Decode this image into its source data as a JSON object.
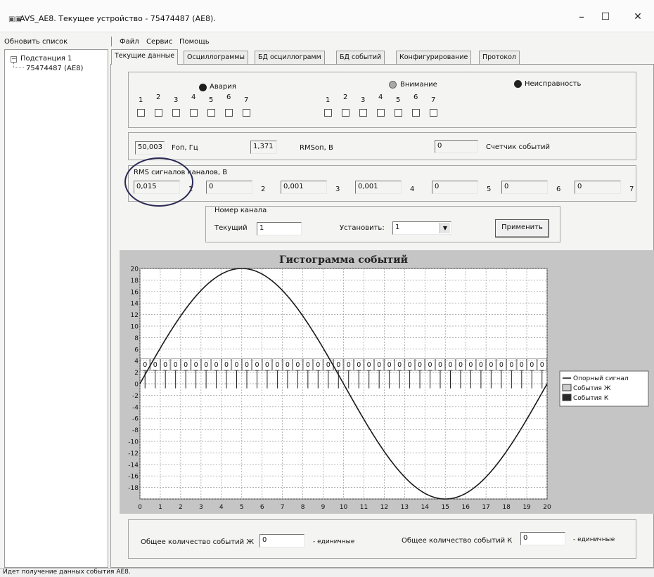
{
  "window": {
    "title": "AVS_AE8. Текущее устройство - 75474487 (AE8).",
    "minimize": "–",
    "maximize": "☐",
    "close": "✕"
  },
  "menu": {
    "refresh_list": "Обновить список",
    "items": [
      "Файл",
      "Сервис",
      "Помощь"
    ]
  },
  "tree": {
    "expander": "−",
    "root": "Подстанция 1",
    "child": "75474487 (AE8)"
  },
  "tabs": [
    "Текущие данные",
    "Осциллограммы",
    "БД осциллограмм",
    "БД событий",
    "Конфигурирование",
    "Протокол"
  ],
  "alarms": {
    "alarm_label": "Авария",
    "attention_label": "Внимание",
    "fault_label": "Неисправность",
    "alarm_color": "#1e1e1e",
    "attention_color": "#a9a9a9",
    "fault_color": "#222222",
    "group1_numbers": [
      "1",
      "2",
      "3",
      "4",
      "5",
      "6",
      "7"
    ],
    "group2_numbers": [
      "1",
      "2",
      "3",
      "4",
      "5",
      "6",
      "7"
    ]
  },
  "measure": {
    "freq_value": "50,003",
    "freq_label": "Fоп, Гц",
    "rms_value": "1,371",
    "rms_label": "RMSоп, В",
    "counter_value": "0",
    "counter_label": "Счетчик событий"
  },
  "rms_channels": {
    "label": "RMS сигналов каналов, В",
    "channels": [
      {
        "value": "0,015",
        "num": "1"
      },
      {
        "value": "0",
        "num": "2"
      },
      {
        "value": "0,001",
        "num": "3"
      },
      {
        "value": "0,001",
        "num": "4"
      },
      {
        "value": "0",
        "num": "5"
      },
      {
        "value": "0",
        "num": "6"
      },
      {
        "value": "0",
        "num": "7"
      }
    ]
  },
  "channel": {
    "group_label": "Номер канала",
    "current_label": "Текущий",
    "current_value": "1",
    "set_label": "Установить:",
    "set_value": "1",
    "apply": "Применить"
  },
  "chart_data": {
    "type": "line",
    "title": "Гистограмма событий",
    "xlim": [
      0,
      20
    ],
    "ylim": [
      -20,
      20
    ],
    "x_ticks": [
      "0",
      "1",
      "2",
      "3",
      "4",
      "5",
      "6",
      "7",
      "8",
      "9",
      "10",
      "11",
      "12",
      "13",
      "14",
      "15",
      "16",
      "17",
      "18",
      "19",
      "20"
    ],
    "y_ticks": [
      "20",
      "18",
      "16",
      "14",
      "12",
      "10",
      "8",
      "6",
      "4",
      "2",
      "0",
      "-2",
      "-4",
      "-6",
      "-8",
      "-10",
      "-12",
      "-14",
      "-16",
      "-18"
    ],
    "grid": true,
    "legend_position": "right",
    "series": [
      {
        "name": "Опорный сигнал",
        "function": "sine",
        "amplitude": 20,
        "period": 20
      },
      {
        "name": "События Ж",
        "values": [
          0,
          0,
          0,
          0,
          0,
          0,
          0,
          0,
          0,
          0,
          0,
          0,
          0,
          0,
          0,
          0,
          0,
          0,
          0,
          0,
          0,
          0,
          0,
          0,
          0,
          0,
          0,
          0,
          0,
          0,
          0,
          0,
          0,
          0,
          0,
          0,
          0,
          0,
          0,
          0
        ],
        "color": "#cccccc"
      },
      {
        "name": "События К",
        "values": [
          0,
          0,
          0,
          0,
          0,
          0,
          0,
          0,
          0,
          0,
          0,
          0,
          0,
          0,
          0,
          0,
          0,
          0,
          0,
          0,
          0,
          0,
          0,
          0,
          0,
          0,
          0,
          0,
          0,
          0,
          0,
          0,
          0,
          0,
          0,
          0,
          0,
          0,
          0,
          0
        ],
        "color": "#2a2a2a"
      }
    ],
    "bar_label": "0"
  },
  "totals": {
    "zh_label": "Общее количество событий Ж",
    "zh_value": "0",
    "zh_unit": "- единичные",
    "k_label": "Общее количество событий К",
    "k_value": "0",
    "k_unit": "- единичные"
  },
  "status": "Идет получение данных события AE8."
}
